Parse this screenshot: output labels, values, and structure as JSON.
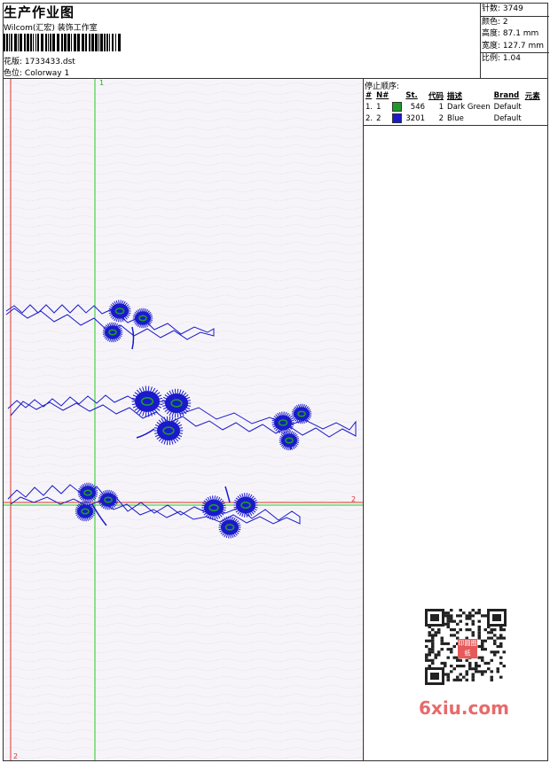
{
  "header": {
    "title": "生产作业图",
    "subtitle": "Wilcom(汇宏) 装饰工作室",
    "design_label": "花版:",
    "design_file": "1733433.dst",
    "colorway_label": "色位:",
    "colorway": "Colorway 1"
  },
  "stats": {
    "stitches": "针数: 3749",
    "colors": "颜色: 2",
    "height": "高度: 87.1 mm",
    "width": "宽度: 127.7 mm",
    "scale": "比例: 1.04"
  },
  "stop_sequence": {
    "title": "停止顺序:",
    "headers": [
      "#",
      "N#",
      "St.",
      "代码",
      "描述",
      "Brand",
      "元素"
    ],
    "rows": [
      {
        "num": "1.",
        "n": "1",
        "color": "#1f9a2a",
        "st": "546",
        "code": "1",
        "desc": "Dark Green",
        "brand": "Default"
      },
      {
        "num": "2.",
        "n": "2",
        "color": "#1a1acc",
        "st": "3201",
        "code": "2",
        "desc": "Blue",
        "brand": "Default"
      }
    ]
  },
  "guides": {
    "marker_top": "1",
    "marker_right": "2",
    "marker_bottom": "2"
  },
  "colors": {
    "blue_thread": "#1a1acc",
    "green_thread": "#1f9a2a",
    "guide_red": "#e03030",
    "guide_green": "#22cc22"
  },
  "watermark": {
    "text": "6xiu.com",
    "qr_logo": "印圆图纸"
  }
}
